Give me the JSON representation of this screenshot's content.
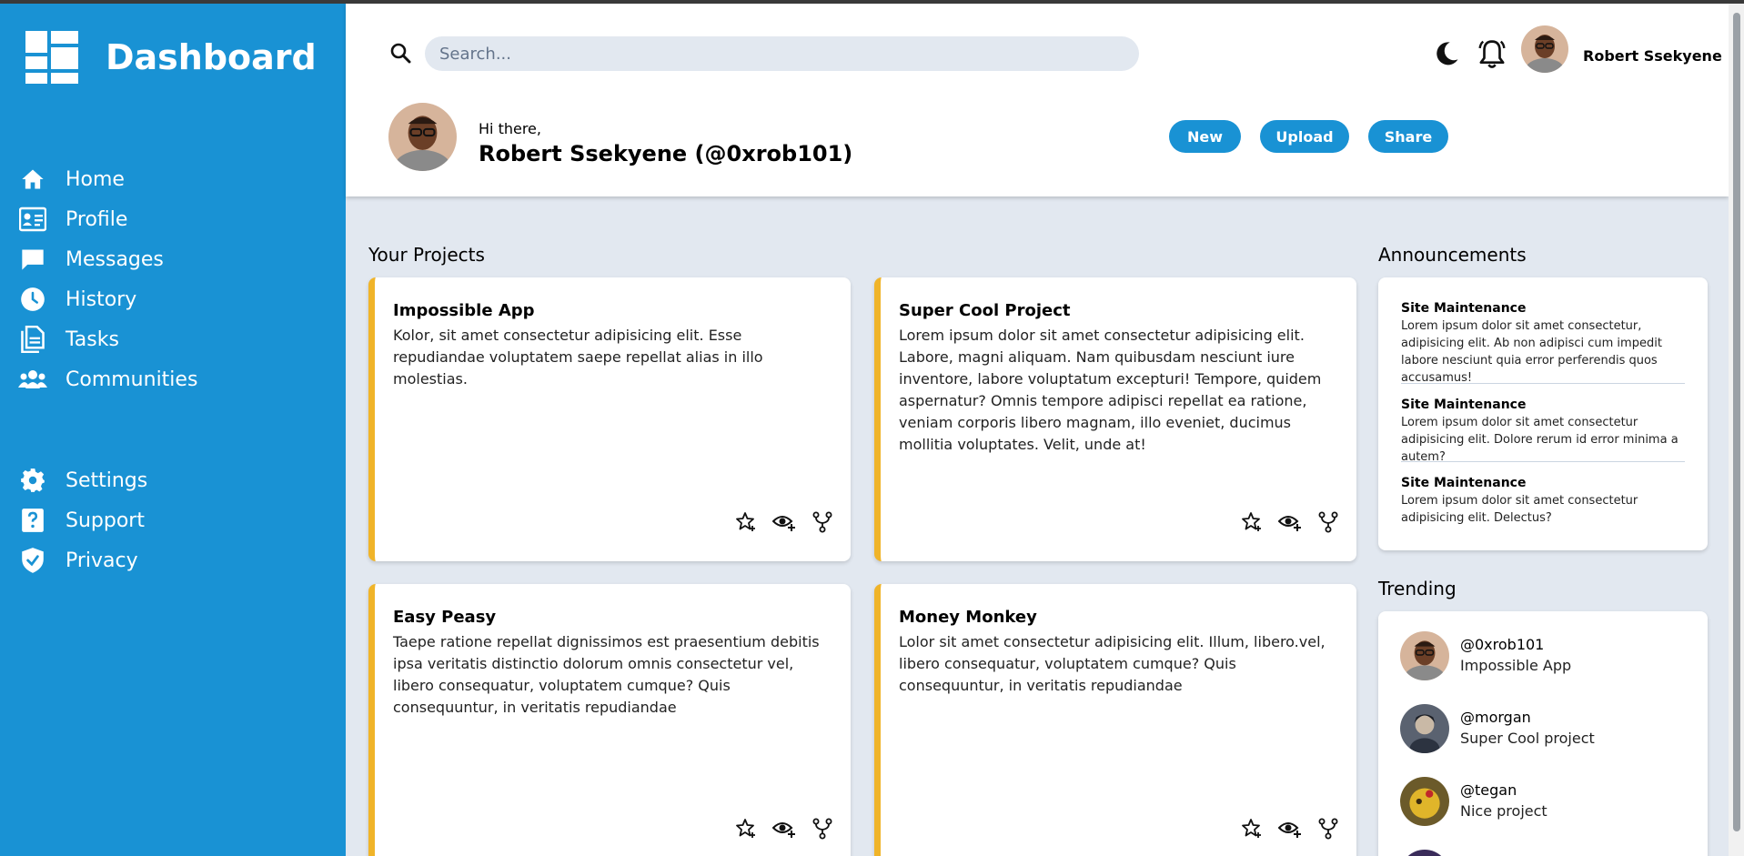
{
  "brand": {
    "title": "Dashboard"
  },
  "nav": {
    "main": [
      {
        "label": "Home",
        "icon": "home-icon"
      },
      {
        "label": "Profile",
        "icon": "profile-card-icon"
      },
      {
        "label": "Messages",
        "icon": "message-icon"
      },
      {
        "label": "History",
        "icon": "clock-icon"
      },
      {
        "label": "Tasks",
        "icon": "document-icon"
      },
      {
        "label": "Communities",
        "icon": "people-icon"
      }
    ],
    "secondary": [
      {
        "label": "Settings",
        "icon": "gear-icon"
      },
      {
        "label": "Support",
        "icon": "help-icon"
      },
      {
        "label": "Privacy",
        "icon": "shield-icon"
      }
    ]
  },
  "header": {
    "search_placeholder": "Search...",
    "user_name": "Robert Ssekyene",
    "greeting": "Hi there,",
    "full_name": "Robert Ssekyene (@0xrob101)",
    "buttons": {
      "new": "New",
      "upload": "Upload",
      "share": "Share"
    }
  },
  "projects": {
    "title": "Your Projects",
    "items": [
      {
        "title": "Impossible App",
        "desc": "Kolor, sit amet consectetur adipisicing elit. Esse repudiandae voluptatem saepe repellat alias in illo molestias."
      },
      {
        "title": "Super Cool Project",
        "desc": "Lorem ipsum dolor sit amet consectetur adipisicing elit. Labore, magni aliquam. Nam quibusdam nesciunt iure inventore, labore voluptatum excepturi! Tempore, quidem aspernatur? Omnis tempore adipisci repellat ea ratione, veniam corporis libero magnam, illo eveniet, ducimus mollitia voluptates. Velit, unde at!"
      },
      {
        "title": "Easy Peasy",
        "desc": "Taepe ratione repellat dignissimos est praesentium debitis ipsa veritatis distinctio dolorum omnis consectetur vel, libero consequatur, voluptatem cumque? Quis consequuntur, in veritatis repudiandae"
      },
      {
        "title": "Money Monkey",
        "desc": "Lolor sit amet consectetur adipisicing elit. Illum, libero.vel, libero consequatur, voluptatem cumque? Quis consequuntur, in veritatis repudiandae"
      }
    ]
  },
  "announcements": {
    "title": "Announcements",
    "items": [
      {
        "title": "Site Maintenance",
        "text": "Lorem ipsum dolor sit amet consectetur, adipisicing elit. Ab non adipisci cum impedit labore nesciunt quia error perferendis quos accusamus!"
      },
      {
        "title": "Site Maintenance",
        "text": "Lorem ipsum dolor sit amet consectetur adipisicing elit. Dolore rerum id error minima a autem?"
      },
      {
        "title": "Site Maintenance",
        "text": "Lorem ipsum dolor sit amet consectetur adipisicing elit. Delectus?"
      }
    ]
  },
  "trending": {
    "title": "Trending",
    "items": [
      {
        "handle": "@0xrob101",
        "project": "Impossible App"
      },
      {
        "handle": "@morgan",
        "project": "Super Cool project"
      },
      {
        "handle": "@tegan",
        "project": "Nice project"
      }
    ]
  },
  "colors": {
    "sidebar": "#1992d4",
    "accent": "#f0b429",
    "background": "#e2e8f0"
  }
}
